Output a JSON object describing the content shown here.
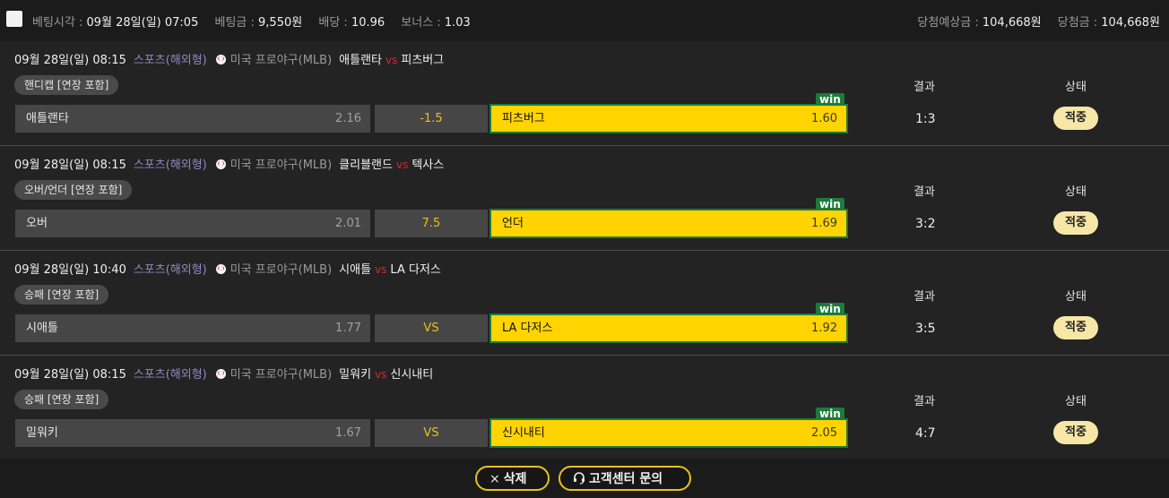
{
  "topbar": {
    "bet_time_label": "베팅시각 :",
    "bet_time": "09월 28일(일) 07:05",
    "bet_amount_label": "베팅금 :",
    "bet_amount": "9,550원",
    "odds_label": "배당 :",
    "odds": "10.96",
    "bonus_label": "보너스 :",
    "bonus": "1.03",
    "expected_label": "당첨예상금 :",
    "expected": "104,668원",
    "won_label": "당첨금 :",
    "won": "104,668원"
  },
  "bets": [
    {
      "datetime": "09월 28일(일) 08:15",
      "category": "스포츠(해외형)",
      "league": "미국 프로야구(MLB)",
      "home": "애틀랜타",
      "vs": "vs",
      "away": "피츠버그",
      "market": "핸디캡 [연장 포함]",
      "home_name": "애틀랜타",
      "home_odds": "2.16",
      "mid": "-1.5",
      "away_name": "피츠버그",
      "away_odds": "1.60",
      "win": "win",
      "result_label": "결과",
      "result": "1:3",
      "status_label": "상태",
      "status": "적중"
    },
    {
      "datetime": "09월 28일(일) 08:15",
      "category": "스포츠(해외형)",
      "league": "미국 프로야구(MLB)",
      "home": "클리블랜드",
      "vs": "vs",
      "away": "텍사스",
      "market": "오버/언더 [연장 포함]",
      "home_name": "오버",
      "home_odds": "2.01",
      "mid": "7.5",
      "away_name": "언더",
      "away_odds": "1.69",
      "win": "win",
      "result_label": "결과",
      "result": "3:2",
      "status_label": "상태",
      "status": "적중"
    },
    {
      "datetime": "09월 28일(일) 10:40",
      "category": "스포츠(해외형)",
      "league": "미국 프로야구(MLB)",
      "home": "시애틀",
      "vs": "vs",
      "away": "LA 다저스",
      "market": "승패 [연장 포함]",
      "home_name": "시애틀",
      "home_odds": "1.77",
      "mid": "VS",
      "away_name": "LA 다저스",
      "away_odds": "1.92",
      "win": "win",
      "result_label": "결과",
      "result": "3:5",
      "status_label": "상태",
      "status": "적중"
    },
    {
      "datetime": "09월 28일(일) 08:15",
      "category": "스포츠(해외형)",
      "league": "미국 프로야구(MLB)",
      "home": "밀워키",
      "vs": "vs",
      "away": "신시내티",
      "market": "승패 [연장 포함]",
      "home_name": "밀워키",
      "home_odds": "1.67",
      "mid": "VS",
      "away_name": "신시내티",
      "away_odds": "2.05",
      "win": "win",
      "result_label": "결과",
      "result": "4:7",
      "status_label": "상태",
      "status": "적중"
    }
  ],
  "footer": {
    "delete_icon": "×",
    "delete_label": "삭제",
    "cs_icon": "headset-icon",
    "cs_label": "고객센터 문의"
  }
}
